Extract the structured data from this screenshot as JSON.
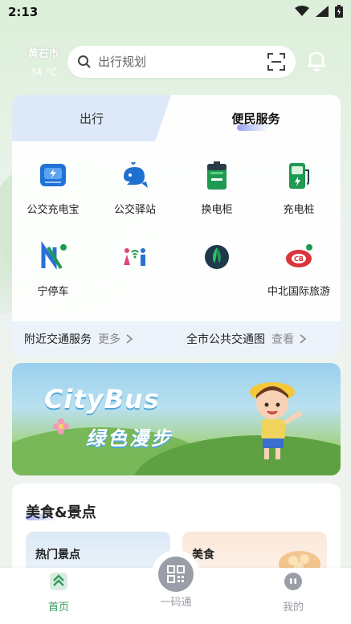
{
  "status_bar": {
    "time": "2:13"
  },
  "header": {
    "city": "黄石市",
    "temperature": "34 °C",
    "search_placeholder": "出行规划"
  },
  "tabs": [
    {
      "label": "出行",
      "active": false
    },
    {
      "label": "便民服务",
      "active": true
    }
  ],
  "services": [
    {
      "label": "公交充电宝",
      "icon": "power-bank-icon"
    },
    {
      "label": "公交驿站",
      "icon": "whale-icon"
    },
    {
      "label": "换电柜",
      "icon": "battery-icon"
    },
    {
      "label": "充电桩",
      "icon": "charging-pile-icon"
    },
    {
      "label": "宁停车",
      "icon": "parking-n-icon"
    },
    {
      "label": "",
      "icon": "restroom-wifi-icon"
    },
    {
      "label": "",
      "icon": "flame-logo-icon"
    },
    {
      "label": "中北国际旅游",
      "icon": "zhongbei-logo-icon"
    }
  ],
  "card_footer": {
    "left_title": "附近交通服务",
    "left_more": "更多",
    "right_title": "全市公共交通图",
    "right_more": "查看"
  },
  "banner": {
    "title_en": "CityBus",
    "title_cn": "绿色漫步"
  },
  "food_section": {
    "title": "美食&景点",
    "cards": [
      {
        "label": "热门景点"
      },
      {
        "label": "美食"
      }
    ]
  },
  "bottom_nav": [
    {
      "label": "首页",
      "active": true
    },
    {
      "label": "一码通",
      "active": false
    },
    {
      "label": "我的",
      "active": false
    }
  ],
  "colors": {
    "accent_green": "#2f9a5a",
    "inactive_gray": "#9a9ea6",
    "tab_active_blue": "#dde9f9"
  }
}
